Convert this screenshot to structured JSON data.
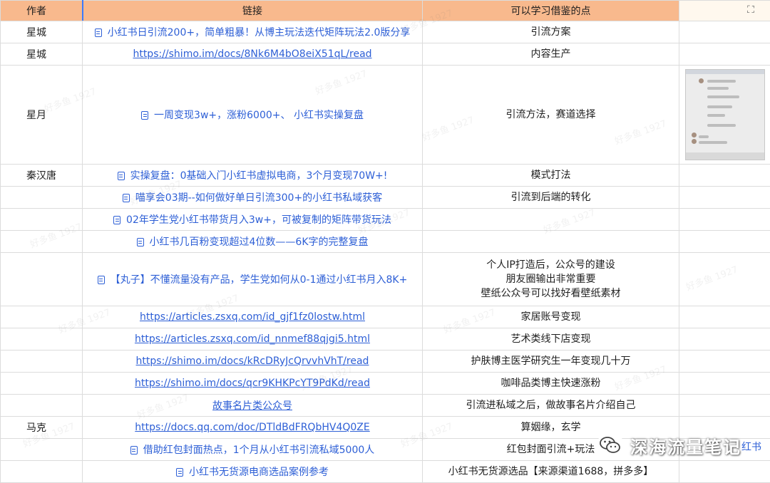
{
  "headers": {
    "author": "作者",
    "link": "链接",
    "note": "可以学习借鉴的点"
  },
  "rows": [
    {
      "author": "星城",
      "link": "小红书日引流200+，简单粗暴！从博主玩法迭代矩阵玩法2.0版分享",
      "link_type": "doc",
      "note": "引流方案"
    },
    {
      "author": "星城",
      "link": "https://shimo.im/docs/8Nk6M4bO8eiX51qL/read",
      "link_type": "url",
      "note": "内容生产"
    },
    {
      "author": "星月",
      "link": "一周变现3w+，涨粉6000+、 小红书实操复盘",
      "link_type": "doc",
      "note": "引流方法，赛道选择",
      "has_image": true
    },
    {
      "author": "秦汉唐",
      "link": "实操复盘：0基础入门小红书虚拟电商，3个月变现70W+!",
      "link_type": "doc",
      "note": "模式打法"
    },
    {
      "author": "",
      "link": "喵享会03期--如何做好单日引流300+的小红书私域获客",
      "link_type": "doc",
      "note": "引流到后端的转化"
    },
    {
      "author": "",
      "link": "02年学生党小红书带货月入3w+，可被复制的矩阵带货玩法",
      "link_type": "doc",
      "note": ""
    },
    {
      "author": "",
      "link": "小红书几百粉变现超过4位数——6K字的完整复盘",
      "link_type": "doc",
      "note": ""
    },
    {
      "author": "",
      "link": "【丸子】不懂流量没有产品，学生党如何从0-1通过小红书月入8K+",
      "link_type": "doc",
      "note_lines": [
        "个人IP打造后，公众号的建设",
        "朋友圈输出非常重要",
        "壁纸公众号可以找好看壁纸素材"
      ]
    },
    {
      "author": "",
      "link": "https://articles.zsxq.com/id_gjf1fz0lostw.html",
      "link_type": "url",
      "note": "家居账号变现"
    },
    {
      "author": "",
      "link": "https://articles.zsxq.com/id_nnmef88qjgi5.html",
      "link_type": "url",
      "note": "艺术类线下店变现"
    },
    {
      "author": "",
      "link": "https://shimo.im/docs/kRcDRyJcQrvvhVhT/read",
      "link_type": "url",
      "note": "护肤博主医学研究生一年变现几十万"
    },
    {
      "author": "",
      "link": "https://shimo.im/docs/qcr9KHKPcYT9PdKd/read",
      "link_type": "url",
      "note": "咖啡品类博主快速涨粉"
    },
    {
      "author": "",
      "link": "故事名片类公众号",
      "link_type": "url",
      "note": "引流进私域之后，做故事名片介绍自己"
    },
    {
      "author": "马克",
      "link": "https://docs.qq.com/doc/DTldBdFRQbHV4Q0ZE",
      "link_type": "url",
      "note": "算姻缘，玄学"
    },
    {
      "author": "",
      "link": "借助红包封面热点，1个月从小红书引流私域5000人",
      "link_type": "doc",
      "note": "红包封面引流+玩法"
    },
    {
      "author": "",
      "link": "小红书无货源电商选品案例参考",
      "link_type": "doc",
      "note": "小红书无货源选品【来源渠道1688，拼多多】"
    }
  ],
  "watermark": "好多鱼 1927",
  "brand": {
    "name": "深海流量笔记",
    "overflow_text": "红书"
  },
  "colors": {
    "header_bg": "#f8b98d",
    "link": "#2d5fd6",
    "grid": "#dcdcdc",
    "selection": "#3a7bff"
  },
  "icons": {
    "expand": "expand-icon",
    "doc": "doc-icon",
    "brand": "wechat-icon"
  }
}
